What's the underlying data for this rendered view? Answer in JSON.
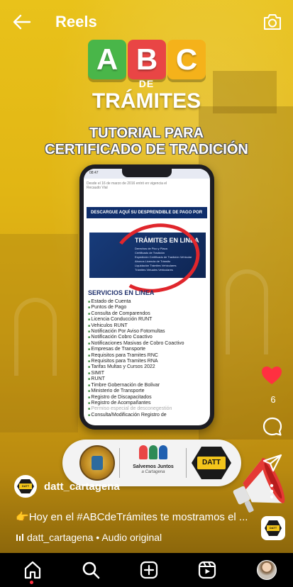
{
  "header": {
    "title": "Reels"
  },
  "video": {
    "abc_letters": [
      "A",
      "B",
      "C"
    ],
    "de": "DE",
    "tramites": "TRÁMITES",
    "tutorial_line1": "TUTORIAL PARA",
    "tutorial_line2": "CERTIFICADO DE TRADICIÓN",
    "phone": {
      "status_time": "08:47",
      "note_line1": "Desde el 16 de marzo de 2016 entró en vigencia el",
      "note_line2": "Recaudo Vial",
      "descargue": "DESCARGUE AQUÍ SU DESPRENDIBLE",
      "descargue_suffix": "DE PAGO POR MULTA",
      "tramites_linea": "TRÁMITES EN LINEA",
      "tl_items": [
        "Derechos de Pico y Placa",
        "Certificado de Tradición",
        "Expedición Certificado de Tradición Vehicular",
        "Abonos Licencia de Tránsito",
        "Liquidación Trámites Vehiculares",
        "Trámites Virtuales Vehiculares"
      ],
      "servicios_title": "SERVICIOS EN LINEA",
      "servicios": [
        "Estado de Cuenta",
        "Puntos de Pago",
        "Consulta de Comparendos",
        "Licencia Conducción RUNT",
        "Vehiculos RUNT",
        "Notificación Por Aviso Fotomultas",
        "Notificación Cobro Coactivo",
        "Notificaciones Masivas de Cobro Coactivo",
        "Empresas de Transporte",
        "Requisitos para Tramites RNC",
        "Requisitos para Tramites RNA",
        "Tarifas Multas y Cursos 2022",
        "SIMIT",
        "RUNT",
        "Timbre Gobernación de Bolivar",
        "Ministerio de Transporte",
        "Registro de Discapacitados",
        "Registro de Acompañantes",
        "Permiso especial de desconegestión",
        "Consulta/Modificación Registro de"
      ]
    },
    "partners": {
      "salvemos_line1": "Salvemos Juntos",
      "salvemos_line2": "a Cartagena",
      "datt": "DATT"
    }
  },
  "actions": {
    "like_count": "6"
  },
  "post": {
    "username": "datt_cartagena",
    "caption_emoji": "👉",
    "caption_pre": "Hoy en el ",
    "caption_hashtag": "#ABCdeTrámites",
    "caption_post": " te mostramos el ...",
    "audio_text": "datt_cartagena • Audio original",
    "badge": "DATT"
  },
  "colors": {
    "background_yellow": "#e1b514",
    "abc_a": "#49b649",
    "abc_b": "#e94545",
    "abc_c": "#f5b21a",
    "like_red": "#ff3040",
    "circle_red": "#e0262c",
    "nav_bg": "#000000"
  },
  "icons": {
    "back": "arrow-left-icon",
    "camera": "camera-icon",
    "like": "heart-icon",
    "comment": "comment-icon",
    "share": "paper-plane-icon",
    "more": "more-vertical-icon",
    "nav": [
      "home-icon",
      "search-icon",
      "create-icon",
      "reels-icon",
      "profile-avatar"
    ]
  }
}
